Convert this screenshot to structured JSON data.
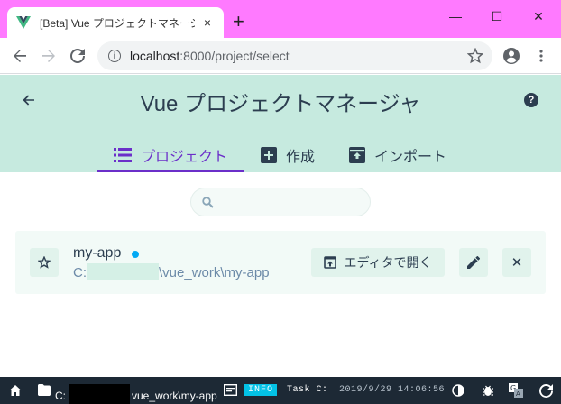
{
  "browser": {
    "tab_title": "[Beta] Vue プロジェクトマネージャ - Vue",
    "tab_close": "×",
    "new_tab": "+",
    "minimize": "—",
    "maximize": "☐",
    "close": "✕",
    "url_host": "localhost",
    "url_path": ":8000/project/select"
  },
  "app": {
    "title": "Vue プロジェクトマネージャ",
    "help": "?",
    "tabs": [
      {
        "label": "プロジェクト",
        "icon": "list-icon",
        "active": true
      },
      {
        "label": "作成",
        "icon": "add-box-icon",
        "active": false
      },
      {
        "label": "インポート",
        "icon": "unarchive-icon",
        "active": false
      }
    ],
    "accent": "#6b2fc9",
    "header_bg": "#c6eadf"
  },
  "search": {
    "placeholder": ""
  },
  "project": {
    "name": "my-app",
    "path_prefix": "C:",
    "path_suffix": "\\vue_work\\my-app",
    "open_label": "エディタで開く",
    "delete_label": "✕",
    "status_color": "#03a9f4"
  },
  "statusbar": {
    "path_prefix": "C:",
    "path_suffix": "vue_work\\my-app",
    "badge": "INFO",
    "message": "Task C:",
    "datetime": "2019/9/29 14:06:56"
  }
}
